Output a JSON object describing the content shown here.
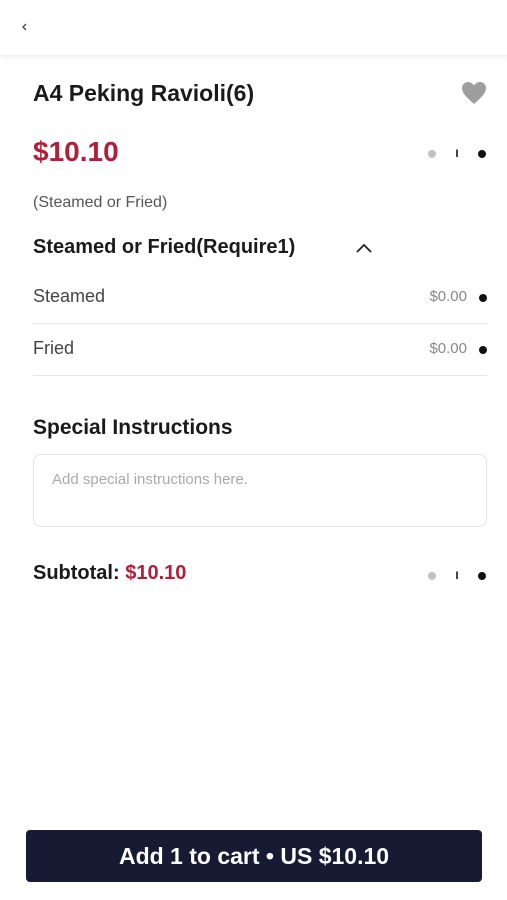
{
  "nav": {
    "back_icon": "chevron-left-icon"
  },
  "item": {
    "name": "A4 Peking Ravioli(6)",
    "price": "$10.10",
    "description": "(Steamed or Fried)",
    "quantity": "I",
    "favorite_icon": "heart-icon"
  },
  "option_group": {
    "title": "Steamed or Fried(Require1)",
    "toggle_icon": "chevron-up-icon",
    "options": [
      {
        "label": "Steamed",
        "price": "$0.00"
      },
      {
        "label": "Fried",
        "price": "$0.00"
      }
    ]
  },
  "special": {
    "title": "Special Instructions",
    "placeholder": "Add special instructions here."
  },
  "subtotal": {
    "label": "Subtotal:",
    "amount": "$10.10",
    "quantity": "I"
  },
  "cta": {
    "label": "Add 1 to cart • US $10.10"
  },
  "colors": {
    "accent": "#b0203a",
    "button_bg": "#161a33",
    "heart": "#9e9e9e"
  }
}
